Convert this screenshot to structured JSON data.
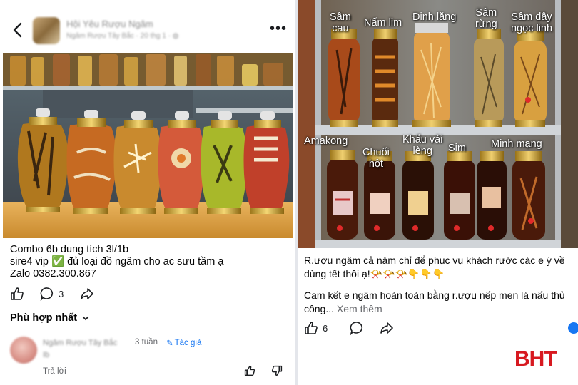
{
  "left_post": {
    "group_name": "Hội Yêu Rượu Ngâm",
    "meta": "Ngâm Rượu Tây Bắc · 20 thg 1 · ",
    "text_lines": [
      "Combo 6b dung tích 3l/1b",
      "sire4 vip ✅ đủ loại đồ ngâm cho ac sưu tầm ạ",
      "Zalo 0382.300.867"
    ],
    "comment_count": "3",
    "sort_label": "Phù hợp nhất",
    "comment": {
      "author": "Ngâm Rượu Tây Bắc",
      "time": "3 tuần",
      "author_badge": "Tác giả",
      "body": "Ib",
      "reply_label": "Trả lời"
    }
  },
  "right_post": {
    "labels": {
      "sam_cau": "Sâm\ncau",
      "nam_lim": "Nấm lim",
      "dinh_lang": "Đinh lăng",
      "sam_rung": "Sâm\nrừng",
      "sam_day": "Sâm dây\nngọc linh",
      "amakong": "Amakong",
      "chuoi_hot": "Chuối\nhột",
      "khau_vai": "Khẩu vải\nlèng",
      "sim": "Sim",
      "minh_mang": "Minh mạng"
    },
    "text_1": "R.ượu ngâm cả năm chỉ để phục vụ khách rước các e ý về dùng tết thôi ạ!📯📯📯👇👇👇",
    "text_2": "Cam kết e ngâm hoàn toàn bằng r.ượu nếp men lá nấu thủ công...",
    "see_more": "Xem thêm",
    "like_count": "6",
    "watermark": "BHT"
  },
  "colors": {
    "accent": "#1877f2",
    "brand_red": "#d71920"
  }
}
